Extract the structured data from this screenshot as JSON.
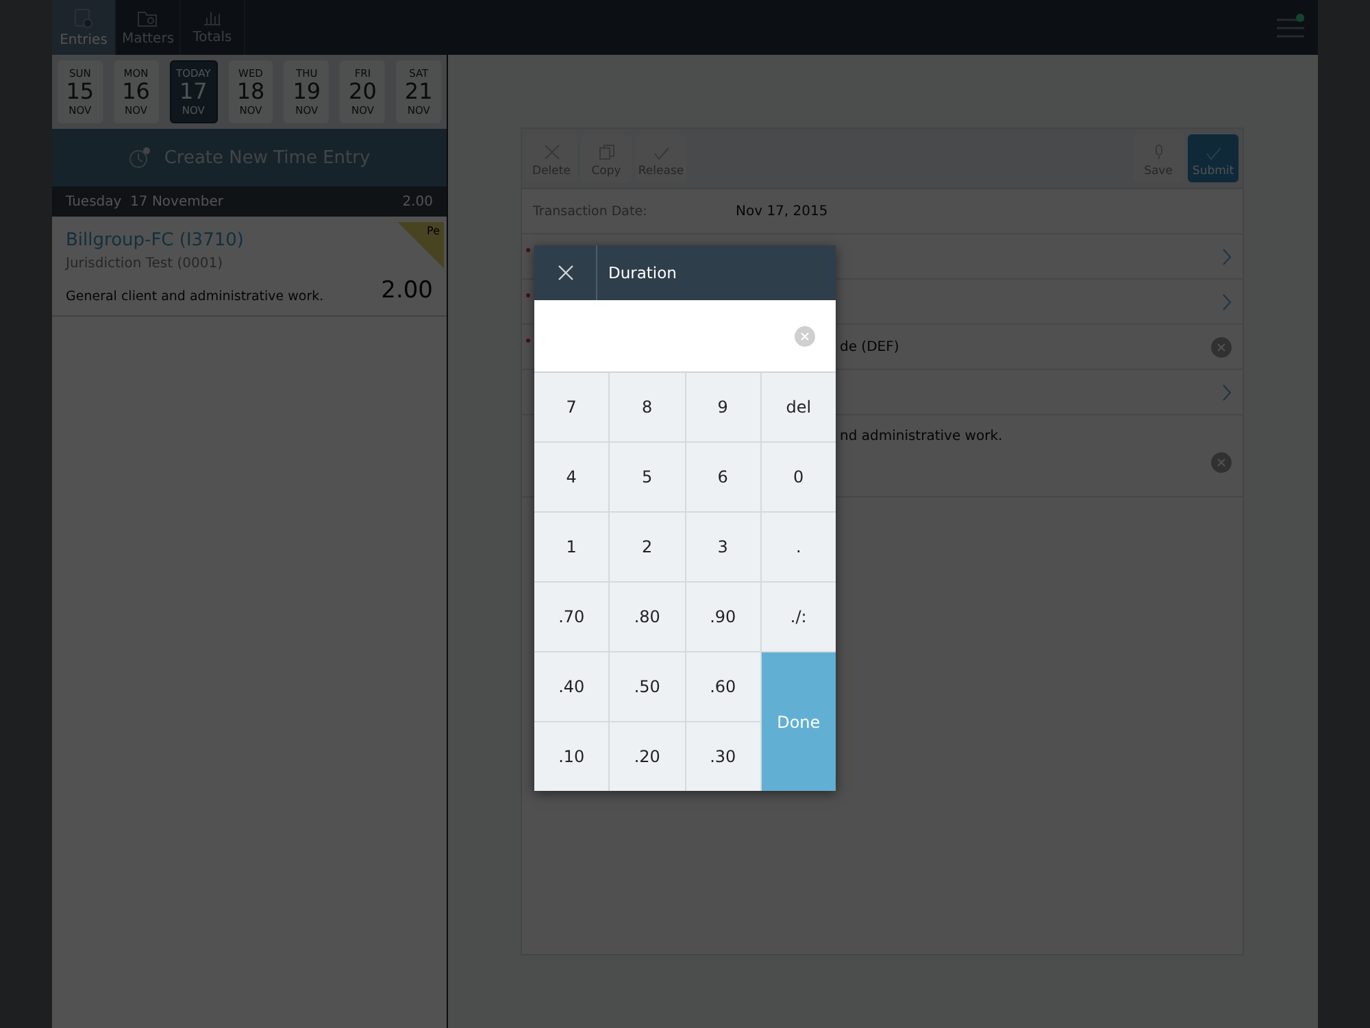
{
  "nav_tabs": [
    {
      "label": "Entries",
      "kind": "entries",
      "selected": true
    },
    {
      "label": "Matters",
      "kind": "matters",
      "selected": false
    },
    {
      "label": "Totals",
      "kind": "totals",
      "selected": false
    }
  ],
  "menu": {
    "notification": true
  },
  "week_days": [
    {
      "weekday": "SUN",
      "day": "15",
      "month": "NOV",
      "selected": false
    },
    {
      "weekday": "MON",
      "day": "16",
      "month": "NOV",
      "selected": false
    },
    {
      "weekday": "TODAY",
      "day": "17",
      "month": "NOV",
      "selected": true
    },
    {
      "weekday": "WED",
      "day": "18",
      "month": "NOV",
      "selected": false
    },
    {
      "weekday": "THU",
      "day": "19",
      "month": "NOV",
      "selected": false
    },
    {
      "weekday": "FRI",
      "day": "20",
      "month": "NOV",
      "selected": false
    },
    {
      "weekday": "SAT",
      "day": "21",
      "month": "NOV",
      "selected": false
    }
  ],
  "create_button": {
    "label": "Create New Time Entry"
  },
  "day_header": {
    "date": "Tuesday  17 November",
    "total": "2.00"
  },
  "entries": [
    {
      "client": "Billgroup-FC (I3710)",
      "matter": "Jurisdiction Test (0001)",
      "description": "General client and administrative work.",
      "hours": "2.00",
      "status_flag": "Pe"
    }
  ],
  "toolbar": [
    {
      "label": "Delete",
      "kind": "delete"
    },
    {
      "label": "Copy",
      "kind": "copy"
    },
    {
      "label": "Release",
      "kind": "release"
    },
    {
      "label": "Save",
      "kind": "save"
    },
    {
      "label": "Submit",
      "kind": "submit"
    }
  ],
  "form": {
    "transaction_date_label": "Transaction Date:",
    "transaction_date": "Nov 17, 2015",
    "rows": [
      {
        "kind": "picker",
        "required": true
      },
      {
        "kind": "picker",
        "required": true
      },
      {
        "kind": "clearable",
        "required": true,
        "value": "de (DEF)"
      },
      {
        "kind": "picker",
        "required": false
      },
      {
        "kind": "note",
        "required": false,
        "value": "nd administrative work."
      }
    ]
  },
  "keypad": {
    "title": "Duration",
    "keys": [
      {
        "label": "7",
        "kind": "key"
      },
      {
        "label": "8",
        "kind": "key"
      },
      {
        "label": "9",
        "kind": "key"
      },
      {
        "label": "del",
        "kind": "key"
      },
      {
        "label": "4",
        "kind": "key"
      },
      {
        "label": "5",
        "kind": "key"
      },
      {
        "label": "6",
        "kind": "key"
      },
      {
        "label": "0",
        "kind": "key"
      },
      {
        "label": "1",
        "kind": "key"
      },
      {
        "label": "2",
        "kind": "key"
      },
      {
        "label": "3",
        "kind": "key"
      },
      {
        "label": ".",
        "kind": "key"
      },
      {
        "label": ".70",
        "kind": "key"
      },
      {
        "label": ".80",
        "kind": "key"
      },
      {
        "label": ".90",
        "kind": "key"
      },
      {
        "label": "./:",
        "kind": "key"
      },
      {
        "label": ".40",
        "kind": "key"
      },
      {
        "label": ".50",
        "kind": "key"
      },
      {
        "label": ".60",
        "kind": "key"
      },
      {
        "label": "Done",
        "kind": "done"
      },
      {
        "label": ".10",
        "kind": "key"
      },
      {
        "label": ".20",
        "kind": "key"
      },
      {
        "label": ".30",
        "kind": "key"
      }
    ]
  }
}
